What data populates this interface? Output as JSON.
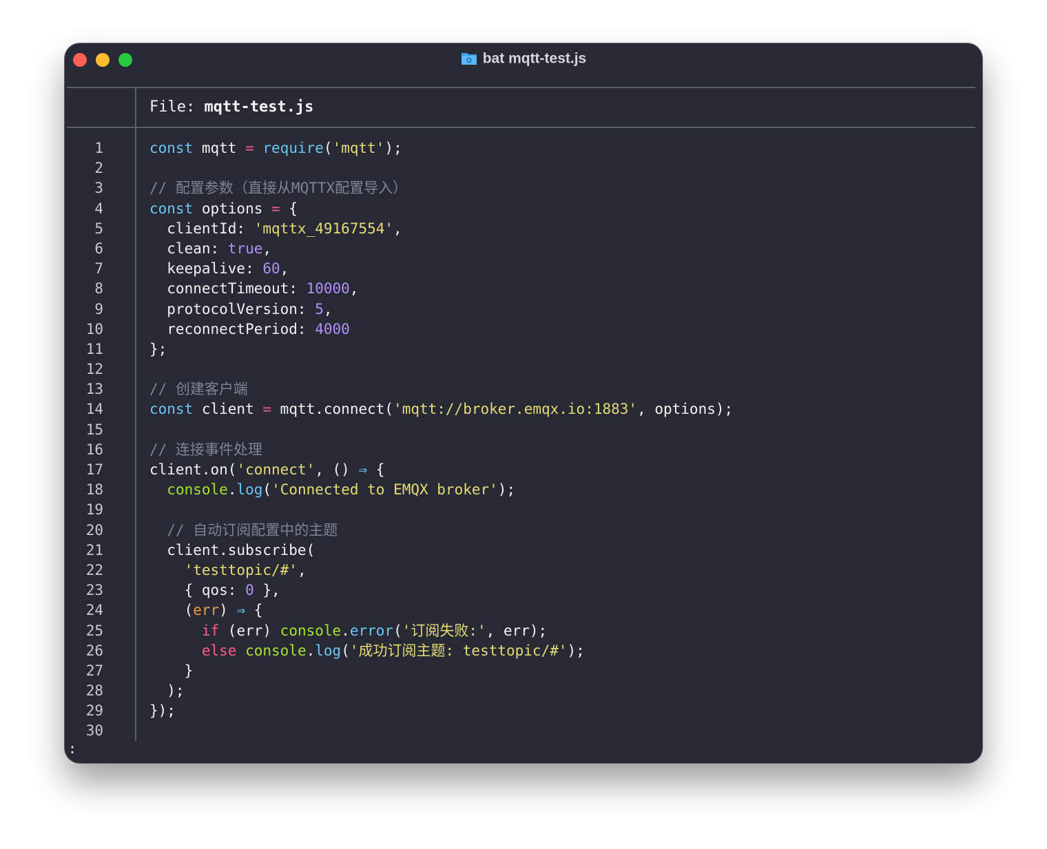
{
  "window": {
    "title": "bat mqtt-test.js",
    "title_icon": "folder-icon",
    "traffic_lights": {
      "close": "#fe5f57",
      "minimize": "#febc2e",
      "zoom": "#28c840"
    }
  },
  "file_header": {
    "label": "File:",
    "filename": "mqtt-test.js"
  },
  "colors": {
    "background": "#272a35",
    "keyword": "#6cc6f3",
    "control_keyword": "#ff5c8a",
    "string": "#e6db74",
    "number": "#b48efa",
    "comment": "#7e8496",
    "console_object": "#a6e22e",
    "parameter": "#f59b3c"
  },
  "lines": [
    {
      "n": "1",
      "tokens": [
        {
          "t": "const",
          "c": "kw"
        },
        {
          "t": " mqtt "
        },
        {
          "t": "=",
          "c": "op"
        },
        {
          "t": " "
        },
        {
          "t": "require",
          "c": "fn"
        },
        {
          "t": "("
        },
        {
          "t": "'mqtt'",
          "c": "str"
        },
        {
          "t": ");"
        }
      ]
    },
    {
      "n": "2",
      "tokens": []
    },
    {
      "n": "3",
      "tokens": [
        {
          "t": "// 配置参数（直接从MQTTX配置导入）",
          "c": "cmt"
        }
      ]
    },
    {
      "n": "4",
      "tokens": [
        {
          "t": "const",
          "c": "kw"
        },
        {
          "t": " options "
        },
        {
          "t": "=",
          "c": "op"
        },
        {
          "t": " {"
        }
      ]
    },
    {
      "n": "5",
      "tokens": [
        {
          "t": "  clientId: "
        },
        {
          "t": "'mqttx_49167554'",
          "c": "str"
        },
        {
          "t": ","
        }
      ]
    },
    {
      "n": "6",
      "tokens": [
        {
          "t": "  clean: "
        },
        {
          "t": "true",
          "c": "num"
        },
        {
          "t": ","
        }
      ]
    },
    {
      "n": "7",
      "tokens": [
        {
          "t": "  keepalive: "
        },
        {
          "t": "60",
          "c": "num"
        },
        {
          "t": ","
        }
      ]
    },
    {
      "n": "8",
      "tokens": [
        {
          "t": "  connectTimeout: "
        },
        {
          "t": "10000",
          "c": "num"
        },
        {
          "t": ","
        }
      ]
    },
    {
      "n": "9",
      "tokens": [
        {
          "t": "  protocolVersion: "
        },
        {
          "t": "5",
          "c": "num"
        },
        {
          "t": ","
        }
      ]
    },
    {
      "n": "10",
      "tokens": [
        {
          "t": "  reconnectPeriod: "
        },
        {
          "t": "4000",
          "c": "num"
        }
      ]
    },
    {
      "n": "11",
      "tokens": [
        {
          "t": "};"
        }
      ]
    },
    {
      "n": "12",
      "tokens": []
    },
    {
      "n": "13",
      "tokens": [
        {
          "t": "// 创建客户端",
          "c": "cmt"
        }
      ]
    },
    {
      "n": "14",
      "tokens": [
        {
          "t": "const",
          "c": "kw"
        },
        {
          "t": " client "
        },
        {
          "t": "=",
          "c": "op"
        },
        {
          "t": " mqtt.connect("
        },
        {
          "t": "'mqtt://broker.emqx.io:1883'",
          "c": "str"
        },
        {
          "t": ", options);"
        }
      ]
    },
    {
      "n": "15",
      "tokens": []
    },
    {
      "n": "16",
      "tokens": [
        {
          "t": "// 连接事件处理",
          "c": "cmt"
        }
      ]
    },
    {
      "n": "17",
      "tokens": [
        {
          "t": "client.on("
        },
        {
          "t": "'connect'",
          "c": "str"
        },
        {
          "t": ", () "
        },
        {
          "t": "⇒",
          "c": "kw"
        },
        {
          "t": " {"
        }
      ]
    },
    {
      "n": "18",
      "tokens": [
        {
          "t": "  "
        },
        {
          "t": "console",
          "c": "obj"
        },
        {
          "t": "."
        },
        {
          "t": "log",
          "c": "fn"
        },
        {
          "t": "("
        },
        {
          "t": "'Connected to EMQX broker'",
          "c": "str"
        },
        {
          "t": ");"
        }
      ]
    },
    {
      "n": "19",
      "tokens": []
    },
    {
      "n": "20",
      "tokens": [
        {
          "t": "  "
        },
        {
          "t": "// 自动订阅配置中的主题",
          "c": "cmt"
        }
      ]
    },
    {
      "n": "21",
      "tokens": [
        {
          "t": "  client.subscribe("
        }
      ]
    },
    {
      "n": "22",
      "tokens": [
        {
          "t": "    "
        },
        {
          "t": "'testtopic/#'",
          "c": "str"
        },
        {
          "t": ","
        }
      ]
    },
    {
      "n": "23",
      "tokens": [
        {
          "t": "    { qos: "
        },
        {
          "t": "0",
          "c": "num"
        },
        {
          "t": " },"
        }
      ]
    },
    {
      "n": "24",
      "tokens": [
        {
          "t": "    ("
        },
        {
          "t": "err",
          "c": "prm"
        },
        {
          "t": ") "
        },
        {
          "t": "⇒",
          "c": "kw"
        },
        {
          "t": " {"
        }
      ]
    },
    {
      "n": "25",
      "tokens": [
        {
          "t": "      "
        },
        {
          "t": "if",
          "c": "kw2"
        },
        {
          "t": " (err) "
        },
        {
          "t": "console",
          "c": "obj"
        },
        {
          "t": "."
        },
        {
          "t": "error",
          "c": "fn"
        },
        {
          "t": "("
        },
        {
          "t": "'订阅失败:'",
          "c": "str"
        },
        {
          "t": ", err);"
        }
      ]
    },
    {
      "n": "26",
      "tokens": [
        {
          "t": "      "
        },
        {
          "t": "else",
          "c": "kw2"
        },
        {
          "t": " "
        },
        {
          "t": "console",
          "c": "obj"
        },
        {
          "t": "."
        },
        {
          "t": "log",
          "c": "fn"
        },
        {
          "t": "("
        },
        {
          "t": "'成功订阅主题: testtopic/#'",
          "c": "str"
        },
        {
          "t": ");"
        }
      ]
    },
    {
      "n": "27",
      "tokens": [
        {
          "t": "    }"
        }
      ]
    },
    {
      "n": "28",
      "tokens": [
        {
          "t": "  );"
        }
      ]
    },
    {
      "n": "29",
      "tokens": [
        {
          "t": "});"
        }
      ]
    },
    {
      "n": "30",
      "tokens": []
    }
  ],
  "prompt": ":"
}
